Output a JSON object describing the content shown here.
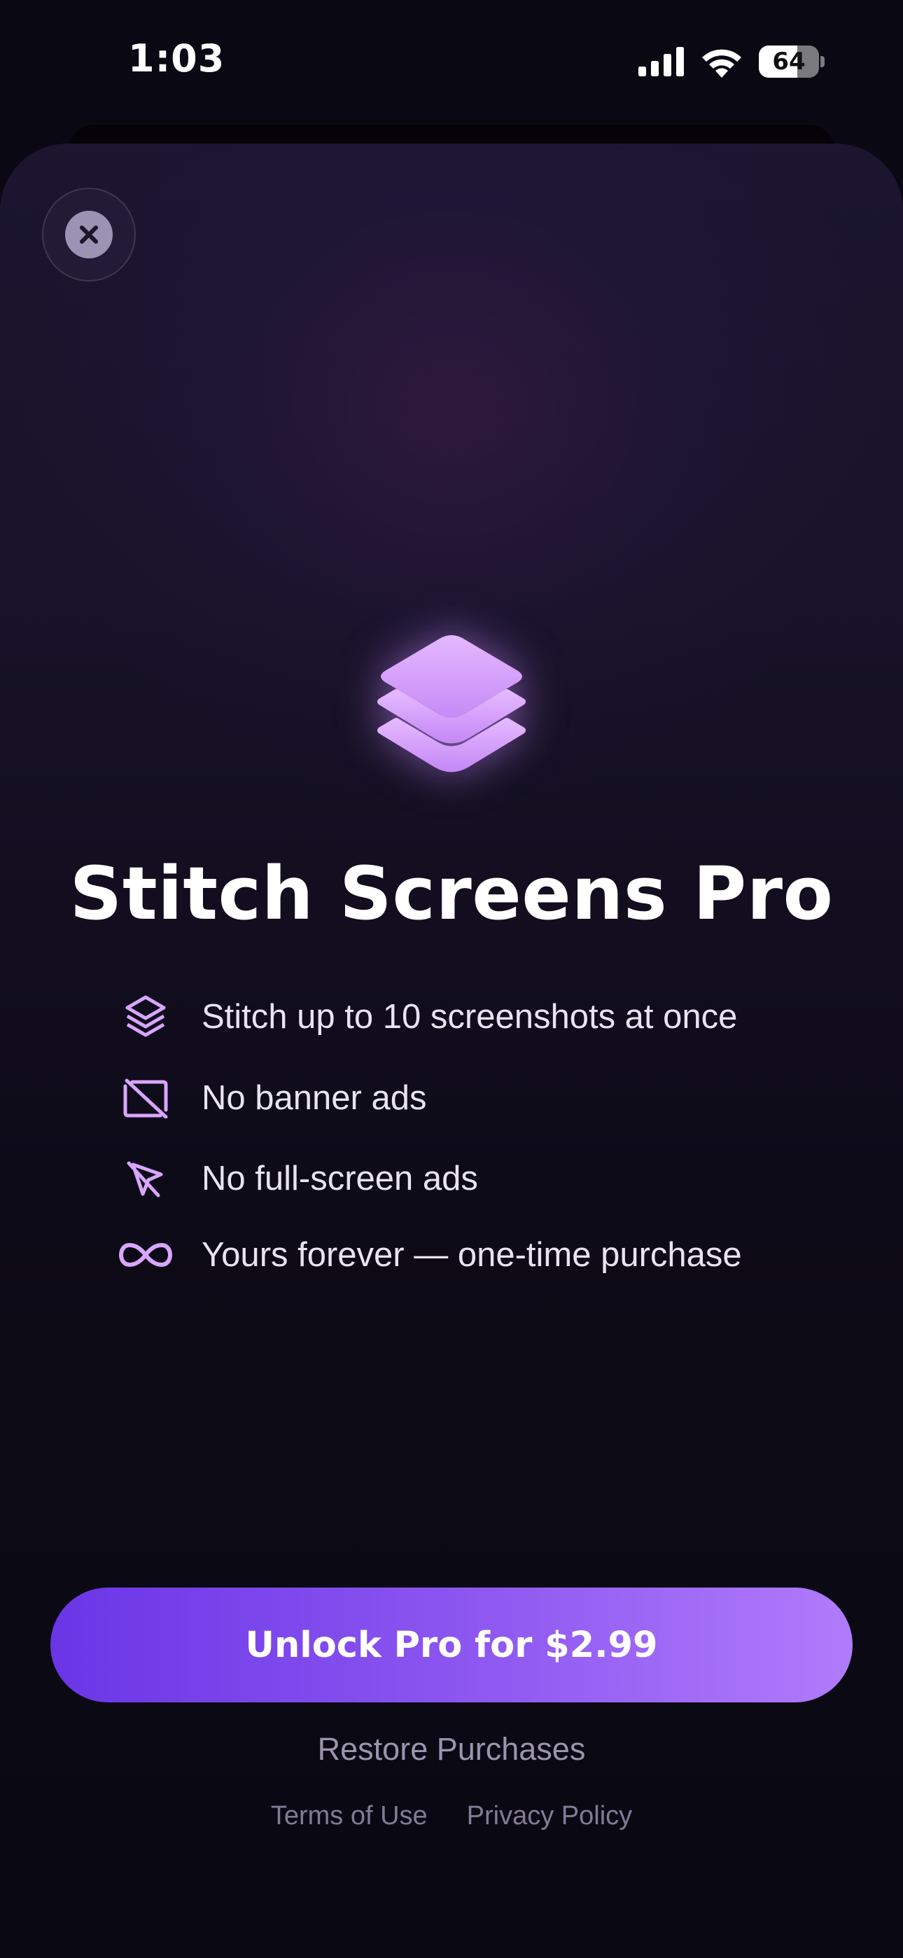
{
  "status_bar": {
    "time": "1:03",
    "battery": "64",
    "battery_level": 0.64
  },
  "paywall": {
    "title": "Stitch Screens Pro",
    "features": [
      {
        "icon": "stack-icon",
        "label": "Stitch up to 10 screenshots at once"
      },
      {
        "icon": "no-banner-ads-icon",
        "label": "No banner ads"
      },
      {
        "icon": "no-fullscreen-ads-icon",
        "label": "No full-screen ads"
      },
      {
        "icon": "infinity-icon",
        "label": "Yours forever — one-time purchase"
      }
    ],
    "cta_label": "Unlock Pro for $2.99",
    "restore_label": "Restore Purchases",
    "terms_label": "Terms of Use",
    "privacy_label": "Privacy Policy"
  },
  "colors": {
    "accent": "#d8a6ff",
    "cta_start": "#6a35e6",
    "cta_end": "#b07bfb",
    "background": "#0a0812"
  }
}
